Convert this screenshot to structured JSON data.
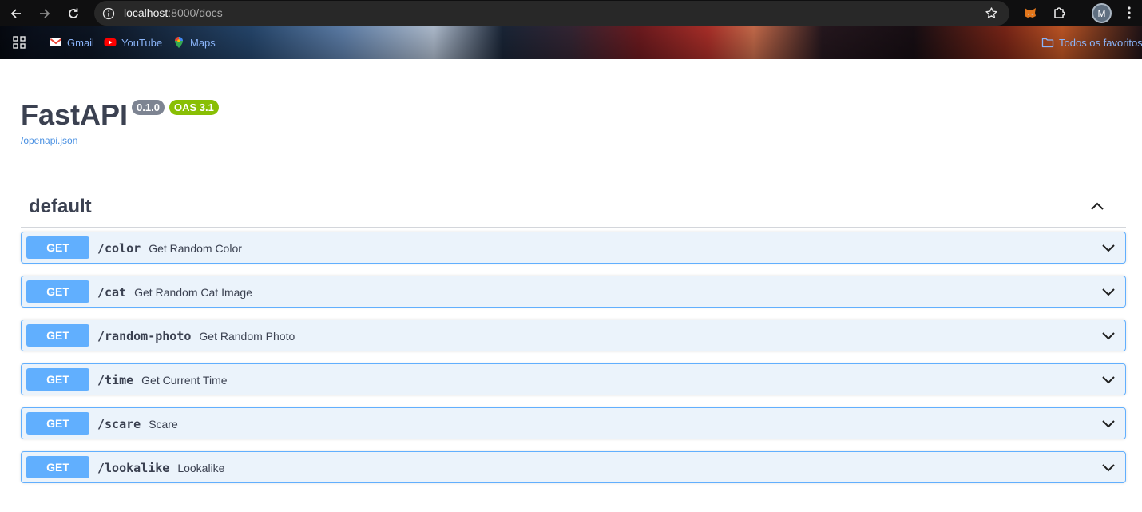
{
  "browser": {
    "url_host": "localhost",
    "url_rest": ":8000/docs",
    "avatar_letter": "M",
    "bookmarks": [
      {
        "label": "Gmail",
        "icon": "gmail-icon"
      },
      {
        "label": "YouTube",
        "icon": "youtube-icon"
      },
      {
        "label": "Maps",
        "icon": "maps-icon"
      }
    ],
    "all_bookmarks_label": "Todos os favoritos"
  },
  "api": {
    "title": "FastAPI",
    "version": "0.1.0",
    "oas": "OAS 3.1",
    "spec_link": "/openapi.json"
  },
  "section": {
    "title": "default"
  },
  "operations": [
    {
      "method": "GET",
      "path": "/color",
      "summary": "Get Random Color"
    },
    {
      "method": "GET",
      "path": "/cat",
      "summary": "Get Random Cat Image"
    },
    {
      "method": "GET",
      "path": "/random-photo",
      "summary": "Get Random Photo"
    },
    {
      "method": "GET",
      "path": "/time",
      "summary": "Get Current Time"
    },
    {
      "method": "GET",
      "path": "/scare",
      "summary": "Scare"
    },
    {
      "method": "GET",
      "path": "/lookalike",
      "summary": "Lookalike"
    }
  ],
  "colors": {
    "get_method": "#61affe",
    "get_bg": "#ebf3fb",
    "oas_badge": "#89bf04",
    "version_badge": "#7d8492",
    "text": "#3b4151",
    "link": "#4990e2"
  }
}
